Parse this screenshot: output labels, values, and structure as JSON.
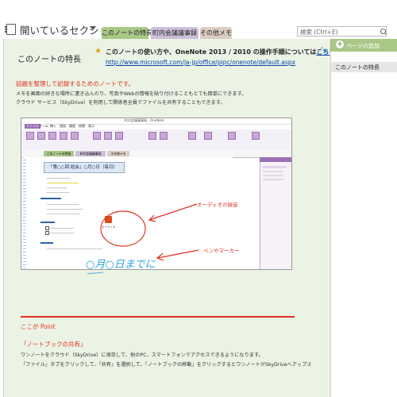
{
  "notebook": {
    "title": "開いているセクション"
  },
  "tabs": [
    {
      "label": "このノートの特長",
      "color": "#a9c787"
    },
    {
      "label": "町内会議議事録",
      "color": "#cdbfd9"
    },
    {
      "label": "その他メモ",
      "color": "#dcccc2"
    }
  ],
  "search": {
    "placeholder": "検索 (Ctrl+E)"
  },
  "page": {
    "heading": "このノートの特長",
    "note_prefix": "このノートの使い方や、OneNote 2013 / 2010 の操作手順については",
    "note_link": "こちら",
    "note_suffix": "から",
    "note_url": "http://www.microsoft.com/ja-jp/office/pipc/onenote/default.aspx",
    "lead": "話題を整理して記録するためのノートです。",
    "body1": "メモを画面の好きな場所に書き込んだり、写真やWebの情報を貼り付けることもとても簡単にできます。",
    "body2": "クラウド サービス（SkyDrive）を利用して関係者全員でファイルを共有することもできます。",
    "point": "ここが Point",
    "sec2_title": "「ノートブックの共有」",
    "sec2_body1": "ワンノートをクラウド（SkyDrive）に保存して、他のPC、スマートフォンでアクセスできるようになります。",
    "sec2_body2": "「ファイル」タブをクリックして、「共有」を選択して、「ノートブックの移動」をクリックするとワンノートがSkyDriveへアップさ"
  },
  "screenshot": {
    "window_title": "町内会議議事録 - OneNote",
    "ribbon_tabs": [
      "ファイル",
      "ホーム",
      "挿入",
      "描画",
      "履歴",
      "校閲",
      "表示"
    ],
    "section_tabs": [
      "このノートの特長",
      "町内会議議事録",
      "その他メモ"
    ],
    "header": "「第○○回 総会」○月○日（毎日）",
    "handwriting": "○月○日までに",
    "audio_label": "オーディオ",
    "ann_audio": "オーディオの録音",
    "ann_pen": "ペンやマーカー"
  },
  "right_panel": {
    "add_page": "ページの追加",
    "pages": [
      "このノートの特長"
    ]
  }
}
